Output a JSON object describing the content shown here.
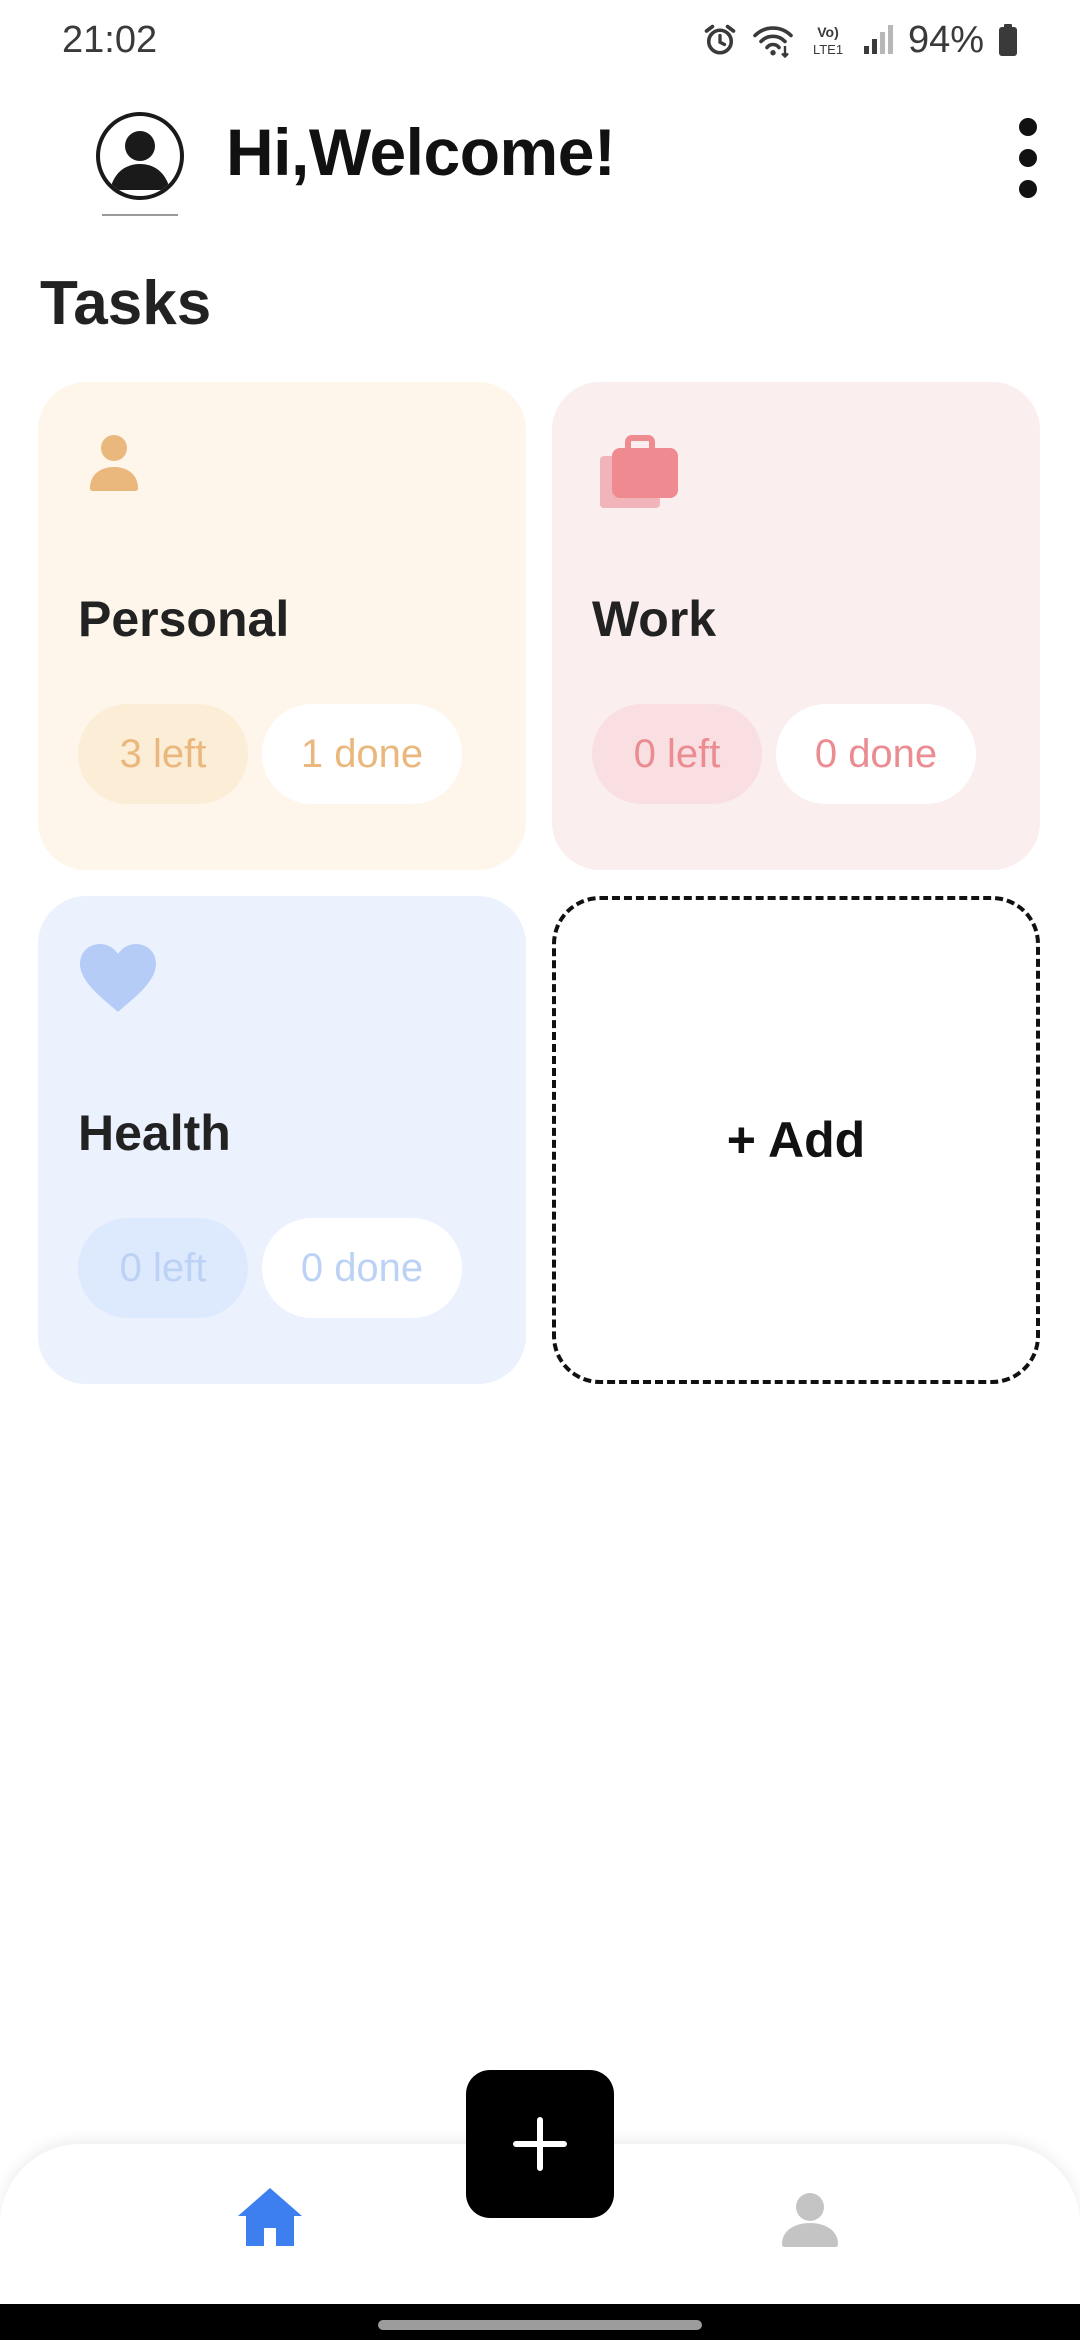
{
  "status_bar": {
    "time": "21:02",
    "battery": "94%",
    "icons": [
      "alarm-icon",
      "wifi-icon",
      "volte-icon",
      "signal-icon",
      "battery-icon"
    ],
    "volte_line1": "Vo)",
    "volte_line2": "LTE1"
  },
  "header": {
    "greeting": "Hi,Welcome!",
    "avatar_icon": "user-circle-icon",
    "menu_icon": "more-vert-icon"
  },
  "section_title": "Tasks",
  "categories": [
    {
      "name": "Personal",
      "icon": "person-icon",
      "left": "3 left",
      "done": "1 done",
      "accent": "#eab77d",
      "bg": "#fef6ea"
    },
    {
      "name": "Work",
      "icon": "briefcase-icon",
      "left": "0 left",
      "done": "0 done",
      "accent": "#ea8c92",
      "bg": "#fbeeef"
    },
    {
      "name": "Health",
      "icon": "heart-icon",
      "left": "0 left",
      "done": "0 done",
      "accent": "#bcd2f5",
      "bg": "#ebf2fe"
    }
  ],
  "add_card": {
    "label": "+ Add"
  },
  "bottom_nav": {
    "items": [
      {
        "name": "home",
        "icon": "home-icon",
        "active": true,
        "color": "#3d7fef"
      },
      {
        "name": "profile",
        "icon": "person-icon",
        "active": false,
        "color": "#c4c4c4"
      }
    ],
    "fab_icon": "plus-icon"
  }
}
